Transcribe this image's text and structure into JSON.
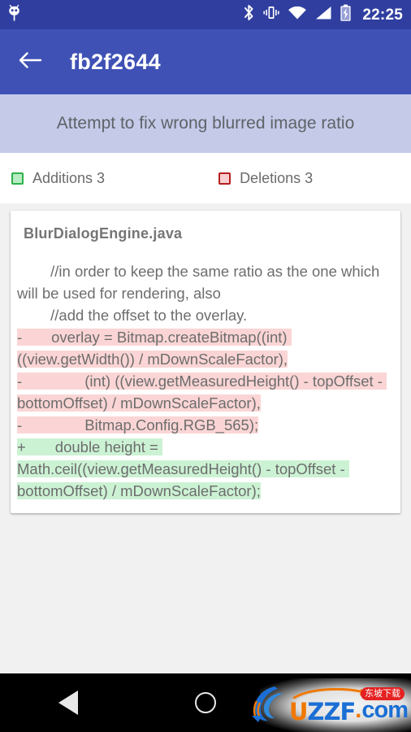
{
  "statusbar": {
    "notification_icon": "octocat-icon",
    "icons": [
      "bluetooth-icon",
      "vibrate-icon",
      "wifi-icon",
      "cellular-signal-icon",
      "battery-charging-icon"
    ],
    "clock": "22:25"
  },
  "appbar": {
    "back_icon": "arrow-back-icon",
    "title": "fb2f2644"
  },
  "commit": {
    "message": "Attempt to fix wrong blurred image ratio"
  },
  "stats": {
    "additions_label": "Additions 3",
    "deletions_label": "Deletions 3",
    "additions_color": "#2eb24b",
    "additions_fill": "#b8ecc3",
    "deletions_color": "#b3201f",
    "deletions_fill": "#fbcfcf"
  },
  "diff": {
    "file_name": "BlurDialogEngine.java",
    "lines": [
      {
        "type": "ctx",
        "text": "        //in order to keep the same ratio as the one which will be used for rendering, also"
      },
      {
        "type": "ctx",
        "text": "        //add the offset to the overlay."
      },
      {
        "type": "del",
        "text": "-       overlay = Bitmap.createBitmap((int) ((view.getWidth()) / mDownScaleFactor),"
      },
      {
        "type": "del",
        "text": "-               (int) ((view.getMeasuredHeight() - topOffset - bottomOffset) / mDownScaleFactor),"
      },
      {
        "type": "del",
        "text": "-               Bitmap.Config.RGB_565);"
      },
      {
        "type": "add",
        "text": "+       double height = Math.ceil((view.getMeasuredHeight() - topOffset - bottomOffset) / mDownScaleFactor);"
      }
    ]
  },
  "navbar": {
    "back": "nav-back-icon",
    "home": "nav-home-icon",
    "recents": "nav-recents-icon"
  },
  "watermark": {
    "u": "U",
    "zz": "ZZ",
    "f": "F",
    "dot": ".",
    "com": "com",
    "badge": "东坡下载"
  }
}
